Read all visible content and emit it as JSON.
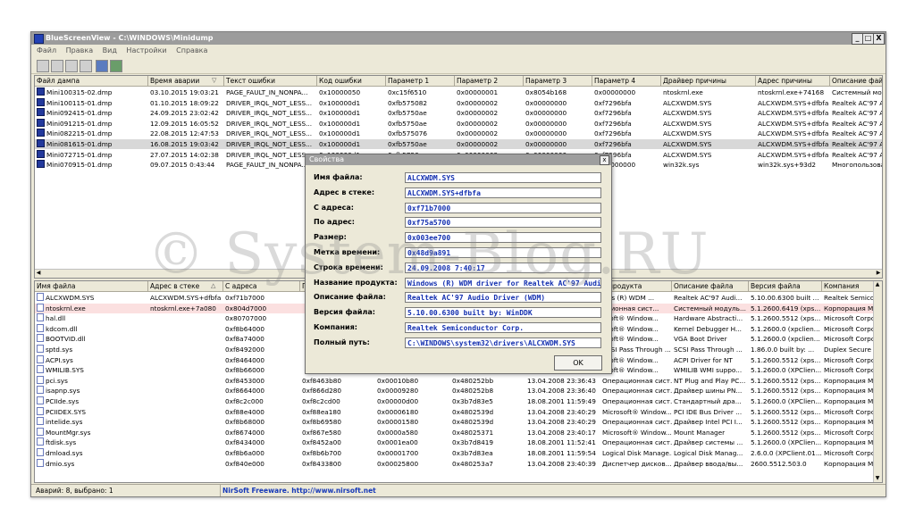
{
  "window": {
    "title": "BlueScreenView  -  C:\\WINDOWS\\Minidump",
    "min": "_",
    "restore": "□",
    "close": "X"
  },
  "menu": [
    "Файл",
    "Правка",
    "Вид",
    "Настройки",
    "Справка"
  ],
  "toolbar": [
    "save-icon",
    "save-all-icon",
    "copy-icon",
    "copy-multiple-icon",
    "find-icon",
    "exit-icon"
  ],
  "dumps": {
    "columns": [
      "Файл дампа",
      "Время аварии",
      "Текст ошибки",
      "Код ошибки",
      "Параметр 1",
      "Параметр 2",
      "Параметр 3",
      "Параметр 4",
      "Драйвер причины",
      "Адрес причины",
      "Описание файла"
    ],
    "sort_mark": "▽",
    "selected_index": 5,
    "rows": [
      [
        "Mini100315-02.dmp",
        "03.10.2015 19:03:21",
        "PAGE_FAULT_IN_NONPA...",
        "0x10000050",
        "0xc15f6510",
        "0x00000001",
        "0x8054b168",
        "0x00000000",
        "ntoskrnl.exe",
        "ntoskrnl.exe+74168",
        "Системный моду"
      ],
      [
        "Mini100115-01.dmp",
        "01.10.2015 18:09:22",
        "DRIVER_IRQL_NOT_LESS...",
        "0x100000d1",
        "0xfb575082",
        "0x00000002",
        "0x00000000",
        "0xf7296bfa",
        "ALCXWDM.SYS",
        "ALCXWDM.SYS+dfbfa",
        "Realtek AC'97 Au"
      ],
      [
        "Mini092415-01.dmp",
        "24.09.2015 23:02:42",
        "DRIVER_IRQL_NOT_LESS...",
        "0x100000d1",
        "0xfb5750ae",
        "0x00000002",
        "0x00000000",
        "0xf7296bfa",
        "ALCXWDM.SYS",
        "ALCXWDM.SYS+dfbfa",
        "Realtek AC'97 Au"
      ],
      [
        "Mini091215-01.dmp",
        "12.09.2015 16:05:52",
        "DRIVER_IRQL_NOT_LESS...",
        "0x100000d1",
        "0xfb5750ae",
        "0x00000002",
        "0x00000000",
        "0xf7296bfa",
        "ALCXWDM.SYS",
        "ALCXWDM.SYS+dfbfa",
        "Realtek AC'97 Au"
      ],
      [
        "Mini082215-01.dmp",
        "22.08.2015 12:47:53",
        "DRIVER_IRQL_NOT_LESS...",
        "0x100000d1",
        "0xfb575076",
        "0x00000002",
        "0x00000000",
        "0xf7296bfa",
        "ALCXWDM.SYS",
        "ALCXWDM.SYS+dfbfa",
        "Realtek AC'97 Au"
      ],
      [
        "Mini081615-01.dmp",
        "16.08.2015 19:03:42",
        "DRIVER_IRQL_NOT_LESS...",
        "0x100000d1",
        "0xfb5750ae",
        "0x00000002",
        "0x00000000",
        "0xf7296bfa",
        "ALCXWDM.SYS",
        "ALCXWDM.SYS+dfbfa",
        "Realtek AC'97 Au"
      ],
      [
        "Mini072715-01.dmp",
        "27.07.2015 14:02:38",
        "DRIVER_IRQL_NOT_LESS...",
        "0x100000d1",
        "0xfb5750ae",
        "0x00000002",
        "0x00000000",
        "0xf7296bfa",
        "ALCXWDM.SYS",
        "ALCXWDM.SYS+dfbfa",
        "Realtek AC'97 Au"
      ],
      [
        "Mini070915-01.dmp",
        "09.07.2015 0:43:44",
        "PAGE_FAULT_IN_NONPA...",
        "",
        "",
        "",
        "",
        "0x00000000",
        "win32k.sys",
        "win32k.sys+93d2",
        "Многопользовате"
      ]
    ]
  },
  "drivers": {
    "columns": [
      "Имя файла",
      "Адрес в стеке",
      "С адреса",
      "П",
      "",
      "",
      "",
      "а продукта",
      "Описание файла",
      "Версия файла",
      "Компания"
    ],
    "sort_mark": "△",
    "highlight_index": 1,
    "rows": [
      [
        "ALCXWDM.SYS",
        "ALCXWDM.SYS+dfbfa",
        "0xf71b7000",
        "",
        "",
        "",
        "",
        "ows (R) WDM ...",
        "Realtek AC'97 Audi...",
        "5.10.00.6300 built ...",
        "Realtek Semicond"
      ],
      [
        "ntoskrnl.exe",
        "ntoskrnl.exe+7a080",
        "0x804d7000",
        "",
        "",
        "",
        "",
        "ационная сист...",
        "Системный модуль...",
        "5.1.2600.6419 (xps...",
        "Корпорация Май"
      ],
      [
        "hal.dll",
        "",
        "0x80707000",
        "",
        "",
        "",
        "",
        "osoft® Window...",
        "Hardware Abstracti...",
        "5.1.2600.5512 (xps...",
        "Microsoft Corpor"
      ],
      [
        "kdcom.dll",
        "",
        "0xf8b64000",
        "",
        "",
        "",
        "",
        "osoft® Window...",
        "Kernel Debugger H...",
        "5.1.2600.0 (xpclien...",
        "Microsoft Corpor"
      ],
      [
        "BOOTVID.dll",
        "",
        "0xf8a74000",
        "",
        "",
        "",
        "",
        "osoft® Window...",
        "VGA Boot Driver",
        "5.1.2600.0 (xpclien...",
        "Microsoft Corpor"
      ],
      [
        "sptd.sys",
        "",
        "0xf8492000",
        "",
        "",
        "",
        "",
        "SCSI Pass Through ...",
        "SCSI Pass Through ...",
        "1.86.0.0 built by: ...",
        "Duplex Secure Lt"
      ],
      [
        "ACPI.sys",
        "",
        "0xf8464000",
        "",
        "",
        "",
        "",
        "osoft® Window...",
        "ACPI Driver for NT",
        "5.1.2600.5512 (xps...",
        "Microsoft Corpor"
      ],
      [
        "WMILIB.SYS",
        "",
        "0xf8b66000",
        "",
        "",
        "",
        "",
        "osoft® Window...",
        "WMILIB WMI suppo...",
        "5.1.2600.0 (XPClien...",
        "Microsoft Corpor"
      ],
      [
        "pci.sys",
        "",
        "0xf8453000",
        "0xf8463b80",
        "0x00010b80",
        "0x480252bb",
        "13.04.2008 23:36:43",
        "Операционная сист...",
        "NT Plug and Play PC...",
        "5.1.2600.5512 (xps...",
        "Корпорация Май"
      ],
      [
        "isapnp.sys",
        "",
        "0xf8664000",
        "0xf866d280",
        "0x00009280",
        "0x480252b8",
        "13.04.2008 23:36:40",
        "Операционная сист...",
        "Драйвер шины PN...",
        "5.1.2600.5512 (xps...",
        "Корпорация Май"
      ],
      [
        "PCIIde.sys",
        "",
        "0xf8c2c000",
        "0xf8c2cd00",
        "0x00000d00",
        "0x3b7d83e5",
        "18.08.2001 11:59:49",
        "Операционная сист...",
        "Стандартный дра...",
        "5.1.2600.0 (XPClien...",
        "Корпорация Май"
      ],
      [
        "PCIIDEX.SYS",
        "",
        "0xf88e4000",
        "0xf88ea180",
        "0x00006180",
        "0x4802539d",
        "13.04.2008 23:40:29",
        "Microsoft® Window...",
        "PCI IDE Bus Driver ...",
        "5.1.2600.5512 (xps...",
        "Microsoft Corpor"
      ],
      [
        "intelide.sys",
        "",
        "0xf8b68000",
        "0xf8b69580",
        "0x00001580",
        "0x4802539d",
        "13.04.2008 23:40:29",
        "Операционная сист...",
        "Драйвер Intel PCI I...",
        "5.1.2600.5512 (xps...",
        "Корпорация Май"
      ],
      [
        "MountMgr.sys",
        "",
        "0xf8674000",
        "0xf867e580",
        "0x0000a580",
        "0x48025371",
        "13.04.2008 23:40:17",
        "Microsoft® Window...",
        "Mount Manager",
        "5.1.2600.5512 (xps...",
        "Microsoft Corpor"
      ],
      [
        "ftdisk.sys",
        "",
        "0xf8434000",
        "0xf8452a00",
        "0x0001ea00",
        "0x3b7d8419",
        "18.08.2001 11:52:41",
        "Операционная сист...",
        "Драйвер системы ...",
        "5.1.2600.0 (XPClien...",
        "Корпорация Май"
      ],
      [
        "dmload.sys",
        "",
        "0xf8b6a000",
        "0xf8b6b700",
        "0x00001700",
        "0x3b7d83ea",
        "18.08.2001 11:59:54",
        "Logical Disk Manage...",
        "Logical Disk Manag...",
        "2.6.0.0 (XPClient.01...",
        "Microsoft Corpor"
      ],
      [
        "dmio.sys",
        "",
        "0xf840e000",
        "0xf8433800",
        "0x00025800",
        "0x480253a7",
        "13.04.2008 23:40:39",
        "Диспетчер дисков...",
        "Драйвер ввода/вы...",
        "2600.5512.503.0",
        "Корпорация Micr"
      ]
    ]
  },
  "status": {
    "summary": "Аварий: 8, выбрано: 1",
    "credit": "NirSoft Freeware.  http://www.nirsoft.net"
  },
  "dialog": {
    "title": "Свойства",
    "close": "x",
    "ok": "OK",
    "fields": [
      {
        "label": "Имя файла:",
        "value": "ALCXWDM.SYS"
      },
      {
        "label": "Адрес в стеке:",
        "value": "ALCXWDM.SYS+dfbfa"
      },
      {
        "label": "С адреса:",
        "value": "0xf71b7000"
      },
      {
        "label": "По адрес:",
        "value": "0xf75a5700"
      },
      {
        "label": "Размер:",
        "value": "0x003ee700"
      },
      {
        "label": "Метка времени:",
        "value": "0x48d9a891"
      },
      {
        "label": "Строка времени:",
        "value": "24.09.2008 7:40:17"
      },
      {
        "label": "Название продукта:",
        "value": "Windows (R) WDM driver for Realtek AC'97 Audi"
      },
      {
        "label": "Описание файла:",
        "value": "Realtek AC'97 Audio Driver (WDM)"
      },
      {
        "label": "Версия файла:",
        "value": "5.10.00.6300 built by: WinDDK"
      },
      {
        "label": "Компания:",
        "value": "Realtek Semiconductor Corp."
      },
      {
        "label": "Полный путь:",
        "value": "C:\\WINDOWS\\system32\\drivers\\ALCXWDM.SYS"
      }
    ]
  },
  "watermark": "© System-Blog.RU"
}
